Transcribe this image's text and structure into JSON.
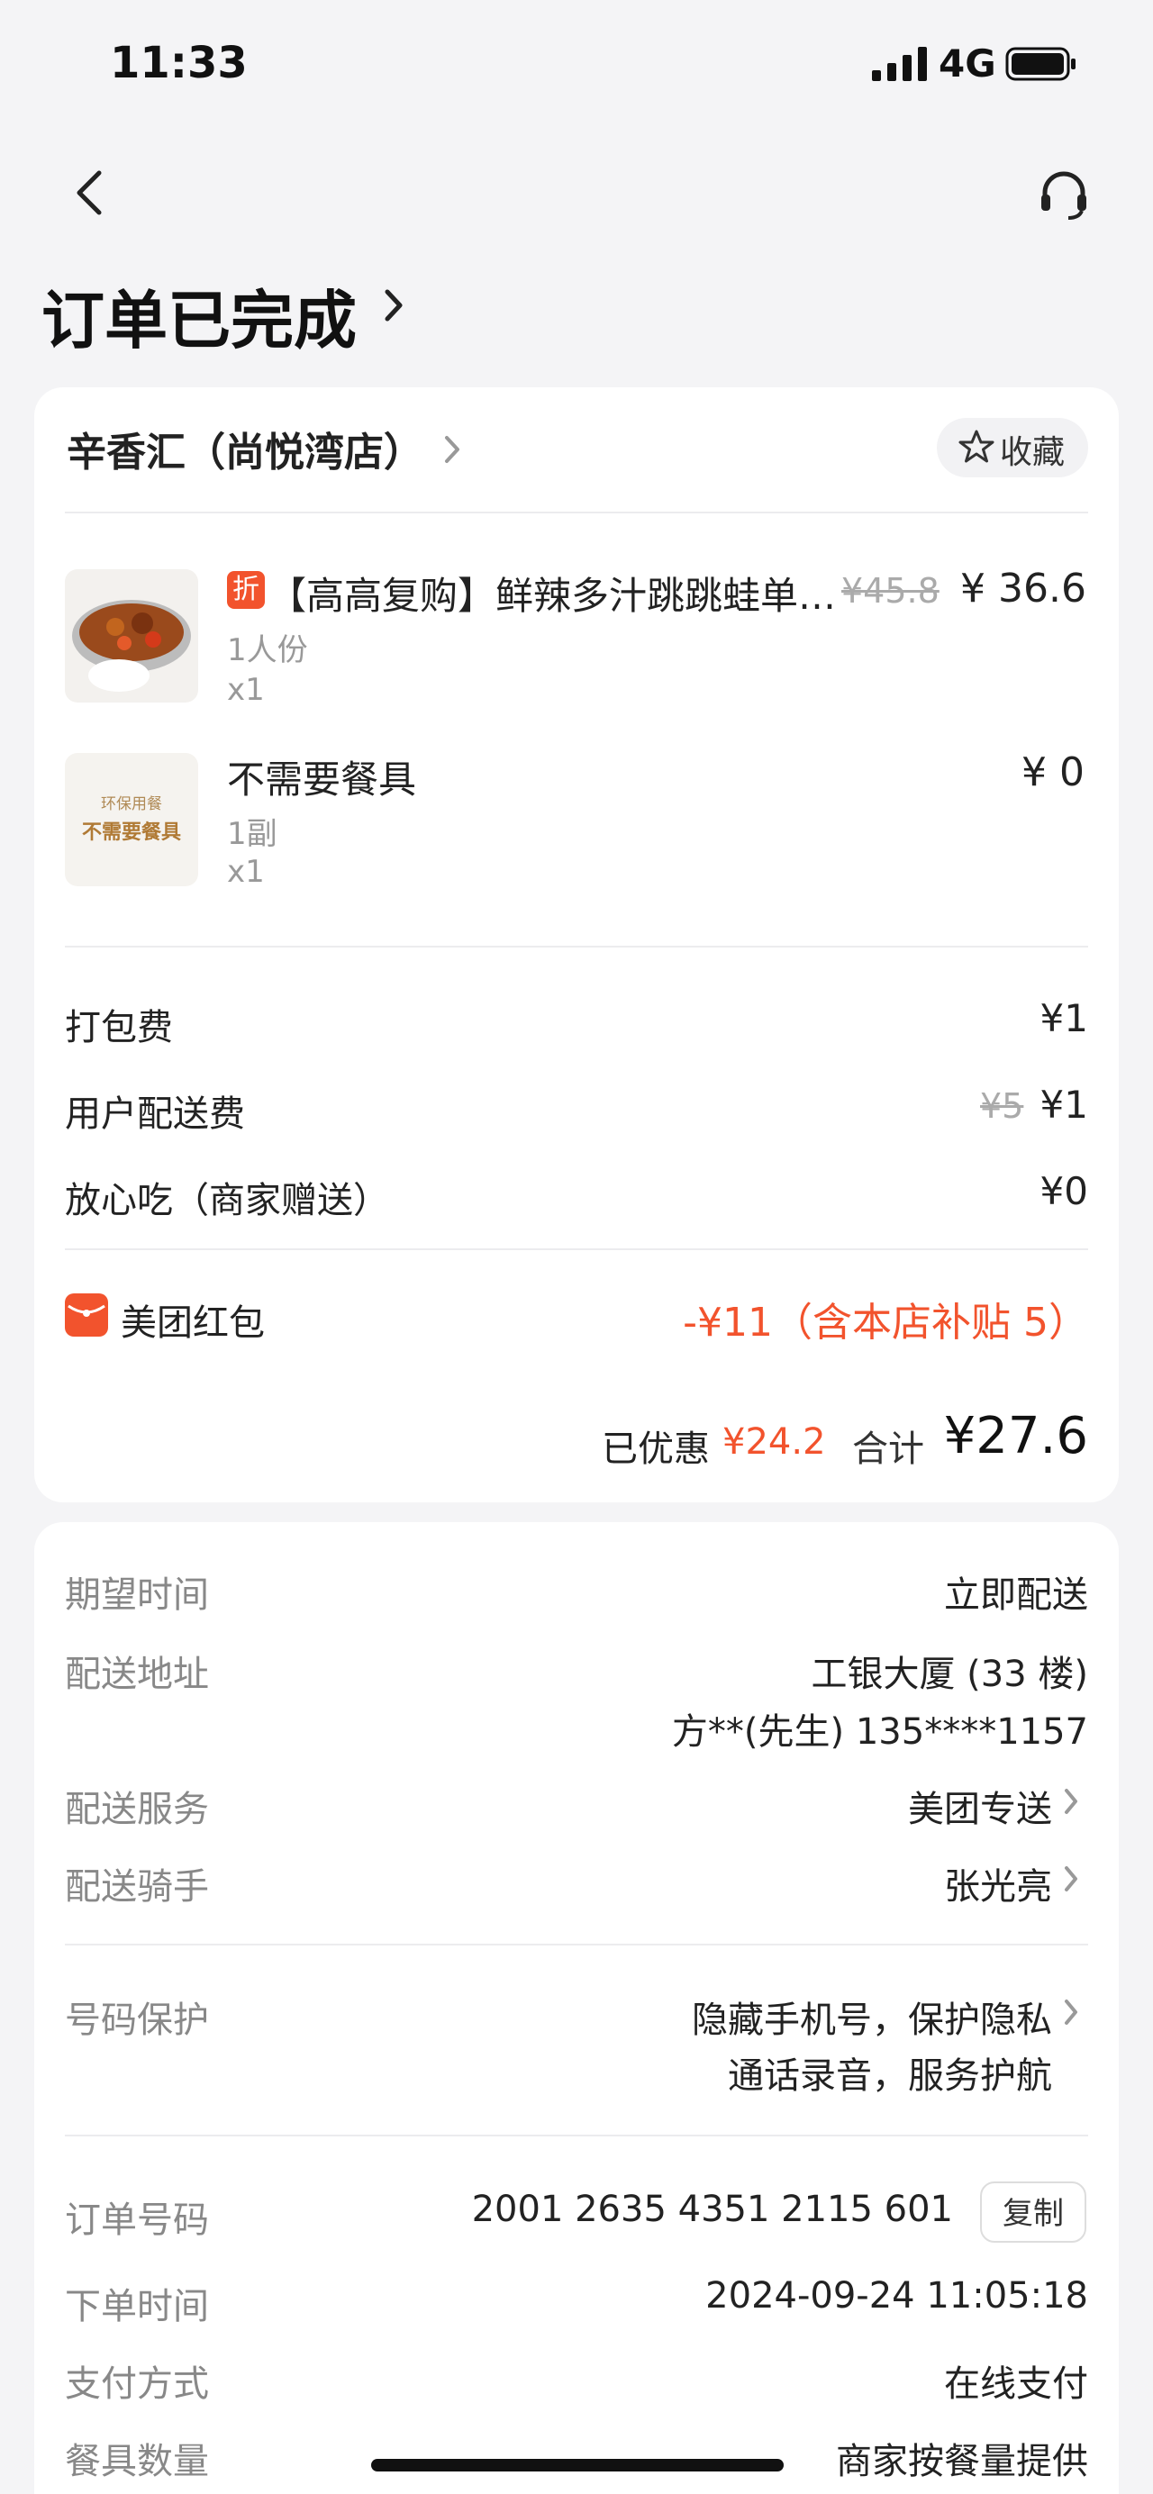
{
  "status_bar": {
    "time": "11:33",
    "network": "4G"
  },
  "page": {
    "title": "订单已完成"
  },
  "store": {
    "name": "辛香汇（尚悦湾店）",
    "favorite_label": "收藏"
  },
  "items": [
    {
      "tag": "折",
      "name": "【高高复购】鲜辣多汁跳跳蛙单…",
      "spec": "1人份",
      "qty": "x1",
      "original_price": "¥45.8",
      "price": "¥ 36.6"
    },
    {
      "name": "不需要餐具",
      "spec": "1副",
      "qty": "x1",
      "price": "¥ 0",
      "thumb_line1": "环保用餐",
      "thumb_line2": "不需要餐具"
    }
  ],
  "fees": {
    "packing_label": "打包费",
    "packing_value": "¥1",
    "delivery_label": "用户配送费",
    "delivery_original": "¥5",
    "delivery_value": "¥1",
    "safe_label": "放心吃（商家赠送）",
    "safe_value": "¥0"
  },
  "redpacket": {
    "label": "美团红包",
    "value": "-¥11（含本店补贴 5）"
  },
  "summary": {
    "saved_label": "已优惠",
    "saved_value": "¥24.2",
    "total_label": "合计",
    "total_value": "¥27.6"
  },
  "delivery": {
    "expected_label": "期望时间",
    "expected_value": "立即配送",
    "address_label": "配送地址",
    "address_line1": "工银大厦 (33 楼)",
    "address_line2": "方**(先生) 135****1157",
    "service_label": "配送服务",
    "service_value": "美团专送",
    "rider_label": "配送骑手",
    "rider_value": "张光亮"
  },
  "privacy": {
    "label": "号码保护",
    "line1": "隐藏手机号，保护隐私",
    "line2": "通话录音，服务护航"
  },
  "order": {
    "number_label": "订单号码",
    "number_value": "2001 2635 4351 2115 601",
    "copy_label": "复制",
    "time_label": "下单时间",
    "time_value": "2024-09-24 11:05:18",
    "pay_label": "支付方式",
    "pay_value": "在线支付",
    "utensil_label": "餐具数量",
    "utensil_value": "商家按餐量提供"
  },
  "colors": {
    "accent_red": "#f2532d",
    "background": "#f4f4f6"
  }
}
